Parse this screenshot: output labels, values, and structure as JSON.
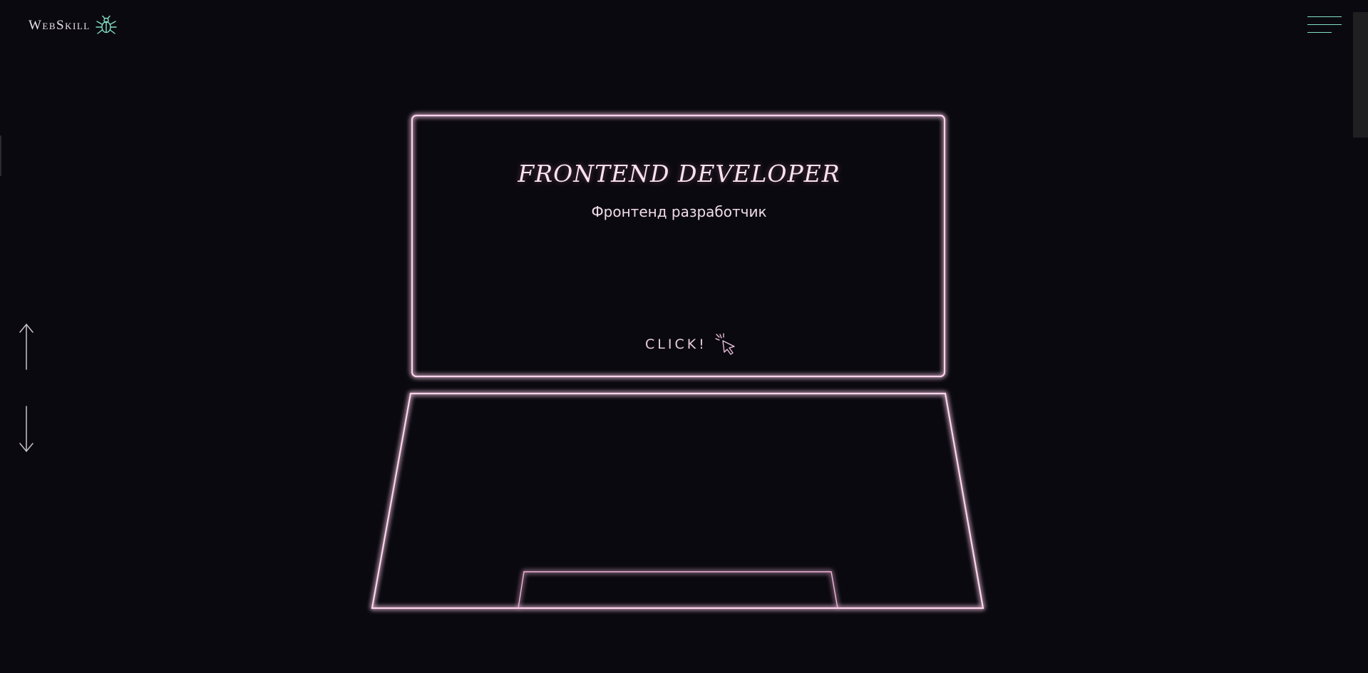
{
  "header": {
    "logo_text": "WebSkill",
    "logo_icon": "bug-icon",
    "menu_icon": "hamburger-menu-icon"
  },
  "side_nav": {
    "up_icon": "arrow-up-icon",
    "down_icon": "arrow-down-icon"
  },
  "screen": {
    "title": "FRONTEND DEVELOPER",
    "subtitle": "Фронтенд разработчик",
    "click_label": "CLICK!",
    "click_icon": "cursor-click-icon"
  },
  "colors": {
    "background": "#0b0910",
    "neon_pink": "#ff9fdc",
    "accent_teal": "#7fe0c4",
    "text": "#f3dfe9"
  }
}
